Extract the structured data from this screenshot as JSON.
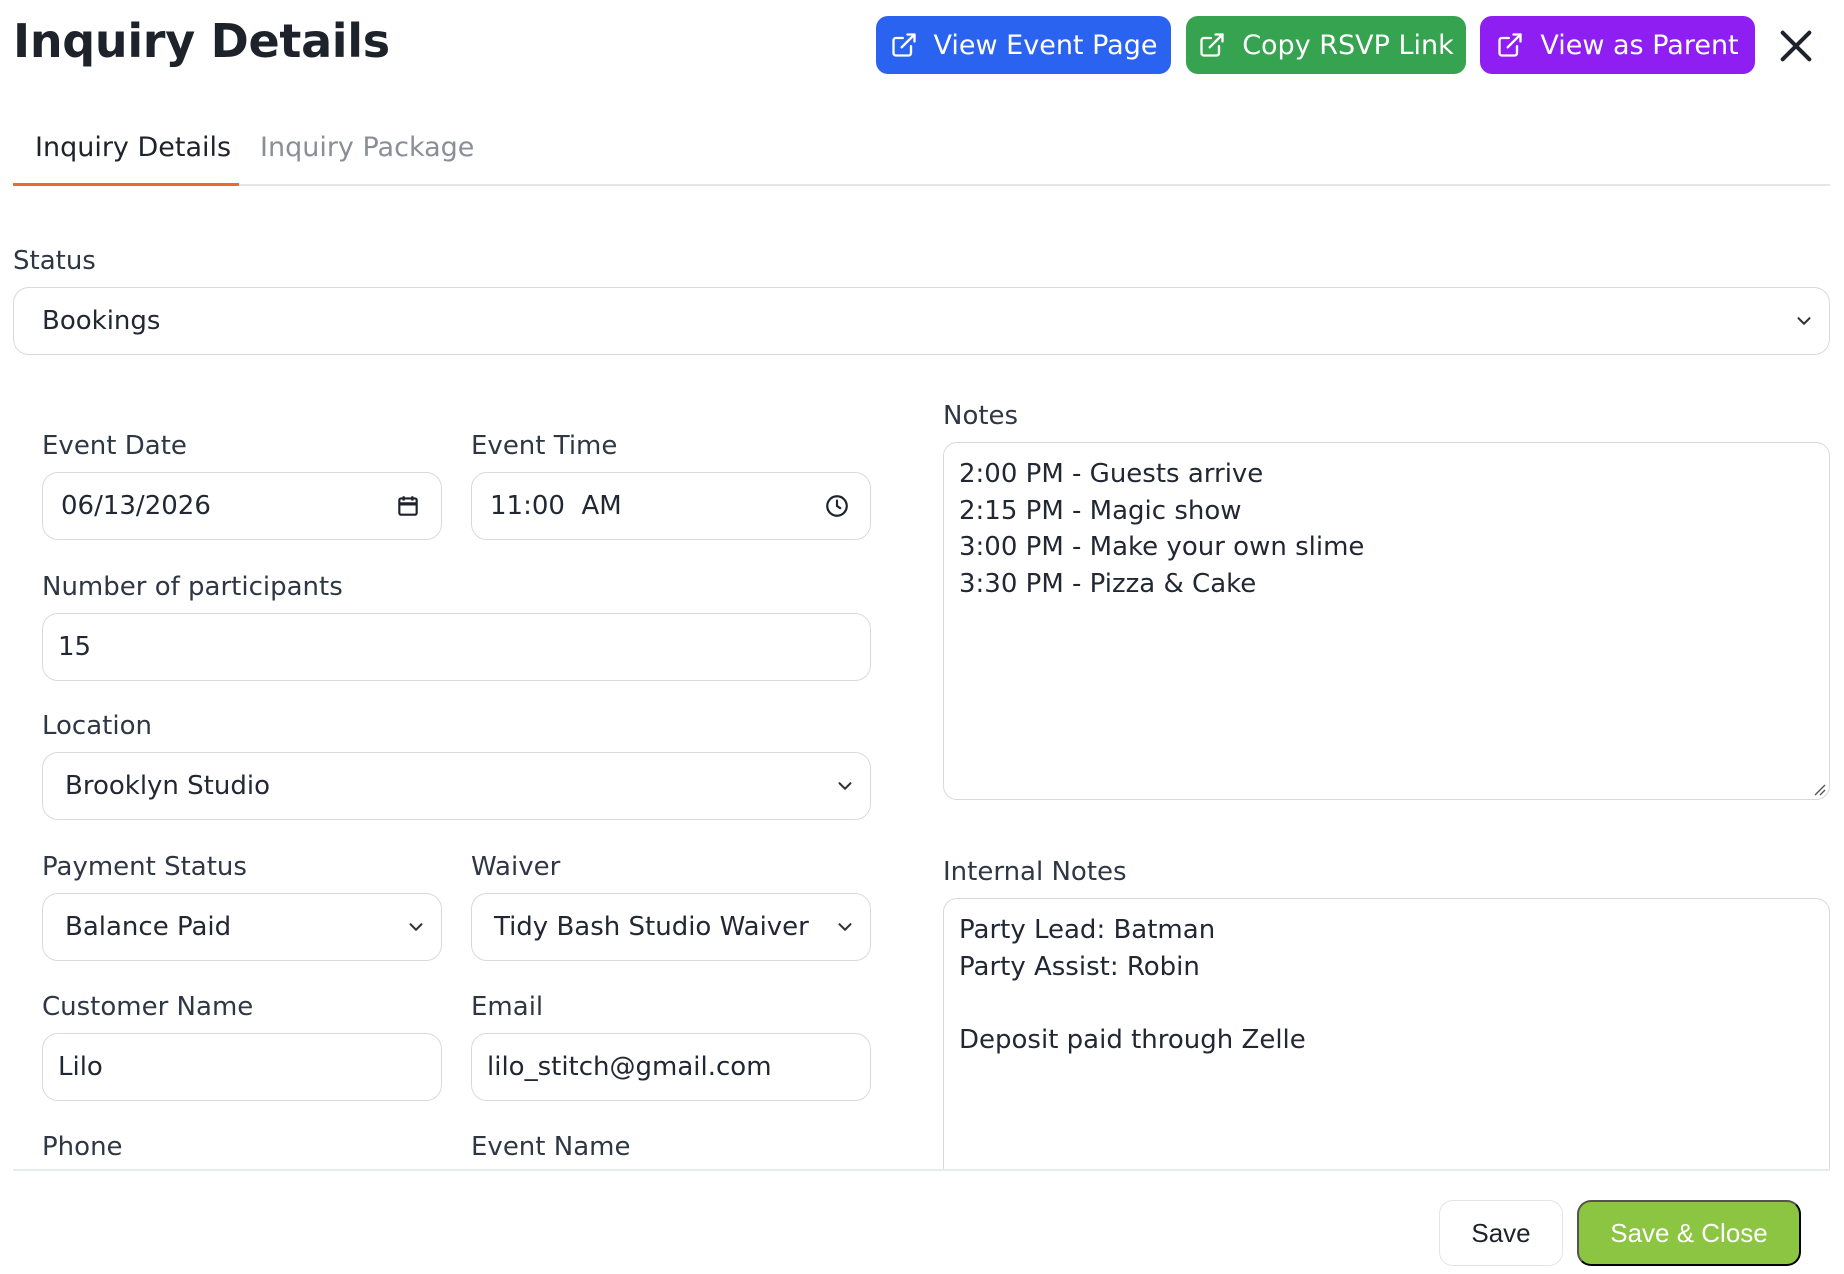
{
  "header": {
    "title": "Inquiry Details",
    "buttons": {
      "view_event_page": "View Event Page",
      "copy_rsvp_link": "Copy RSVP Link",
      "view_as_parent": "View as Parent"
    },
    "icons": {
      "external_link": "external-link-icon",
      "close": "close-icon"
    }
  },
  "tabs": [
    {
      "label": "Inquiry Details",
      "active": true
    },
    {
      "label": "Inquiry Package",
      "active": false
    }
  ],
  "form": {
    "status": {
      "label": "Status",
      "value": "Bookings"
    },
    "event_date": {
      "label": "Event Date",
      "value": "06/13/2026"
    },
    "event_time": {
      "label": "Event Time",
      "value": "11:00  AM"
    },
    "participants": {
      "label": "Number of participants",
      "value": "15"
    },
    "location": {
      "label": "Location",
      "value": "Brooklyn Studio"
    },
    "payment_status": {
      "label": "Payment Status",
      "value": "Balance Paid"
    },
    "waiver": {
      "label": "Waiver",
      "value": "Tidy Bash Studio Waiver"
    },
    "customer_name": {
      "label": "Customer Name",
      "value": "Lilo"
    },
    "email": {
      "label": "Email",
      "value": "lilo_stitch@gmail.com"
    },
    "phone": {
      "label": "Phone"
    },
    "event_name": {
      "label": "Event Name"
    },
    "notes": {
      "label": "Notes",
      "lines": [
        "2:00 PM - Guests arrive",
        "2:15 PM - Magic show",
        "3:00 PM - Make your own slime",
        "3:30 PM - Pizza & Cake"
      ]
    },
    "internal_notes": {
      "label": "Internal Notes",
      "lines": [
        "Party Lead: Batman",
        "Party Assist: Robin",
        "",
        "Deposit paid through Zelle"
      ]
    }
  },
  "footer": {
    "save": "Save",
    "save_close": "Save & Close"
  },
  "colors": {
    "blue": "#2b63f1",
    "green": "#35a34f",
    "purple": "#8f1ef2",
    "tab_accent": "#ee6a2c",
    "save_close": "#8bc541"
  }
}
